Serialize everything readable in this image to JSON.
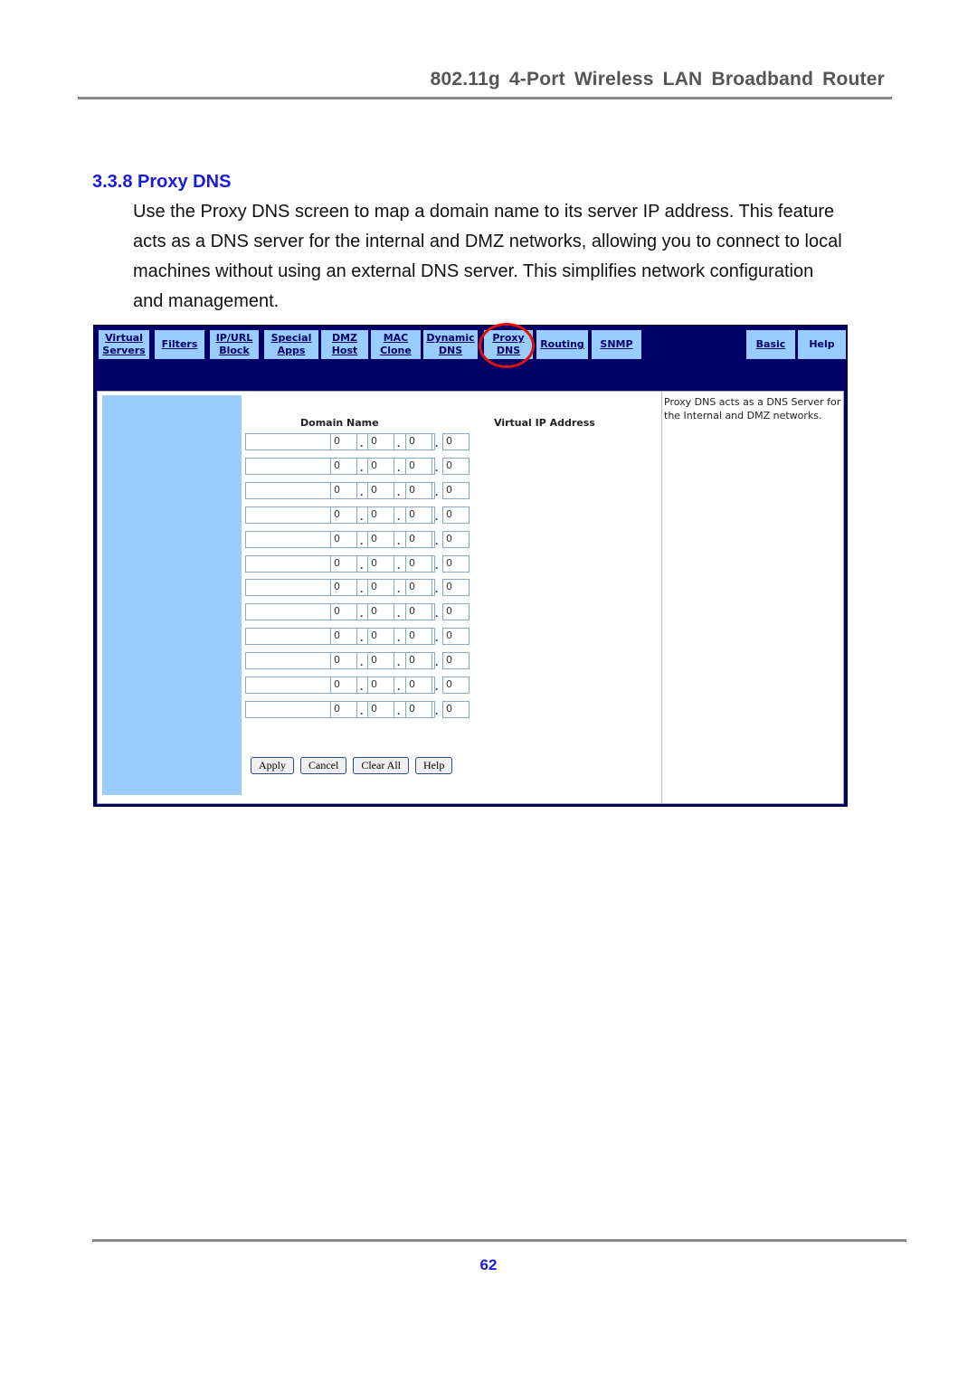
{
  "header": {
    "title": "802.11g 4-Port Wireless LAN Broadband Router"
  },
  "section": {
    "title": "3.3.8 Proxy DNS",
    "body": "Use the Proxy DNS screen to map a domain name to its server IP address. This feature acts as a DNS server for the internal and DMZ networks, allowing you to connect to local machines without using an external DNS server. This simplifies network configuration and management."
  },
  "router_ui": {
    "tabs": [
      {
        "label": "Virtual Servers"
      },
      {
        "label": "Filters"
      },
      {
        "label": "IP/URL Block"
      },
      {
        "label": "Special Apps"
      },
      {
        "label": "DMZ Host"
      },
      {
        "label": "MAC Clone"
      },
      {
        "label": "Dynamic DNS"
      },
      {
        "label": "Proxy DNS",
        "selected": true
      },
      {
        "label": "Routing"
      },
      {
        "label": "SNMP"
      },
      {
        "label": "Basic"
      },
      {
        "label": "Help"
      }
    ],
    "highlight_color": "#e01010",
    "columns": {
      "domain": "Domain Name",
      "ip": "Virtual IP Address"
    },
    "rows": [
      {
        "domain": "",
        "ip": [
          "0",
          "0",
          "0",
          "0"
        ]
      },
      {
        "domain": "",
        "ip": [
          "0",
          "0",
          "0",
          "0"
        ]
      },
      {
        "domain": "",
        "ip": [
          "0",
          "0",
          "0",
          "0"
        ]
      },
      {
        "domain": "",
        "ip": [
          "0",
          "0",
          "0",
          "0"
        ]
      },
      {
        "domain": "",
        "ip": [
          "0",
          "0",
          "0",
          "0"
        ]
      },
      {
        "domain": "",
        "ip": [
          "0",
          "0",
          "0",
          "0"
        ]
      },
      {
        "domain": "",
        "ip": [
          "0",
          "0",
          "0",
          "0"
        ]
      },
      {
        "domain": "",
        "ip": [
          "0",
          "0",
          "0",
          "0"
        ]
      },
      {
        "domain": "",
        "ip": [
          "0",
          "0",
          "0",
          "0"
        ]
      },
      {
        "domain": "",
        "ip": [
          "0",
          "0",
          "0",
          "0"
        ]
      },
      {
        "domain": "",
        "ip": [
          "0",
          "0",
          "0",
          "0"
        ]
      },
      {
        "domain": "",
        "ip": [
          "0",
          "0",
          "0",
          "0"
        ]
      }
    ],
    "buttons": {
      "apply": "Apply",
      "cancel": "Cancel",
      "clear_all": "Clear All",
      "help": "Help"
    },
    "help_text": "Proxy DNS acts as a DNS Server for the Internal and DMZ networks."
  },
  "footer": {
    "page_number": "62"
  }
}
